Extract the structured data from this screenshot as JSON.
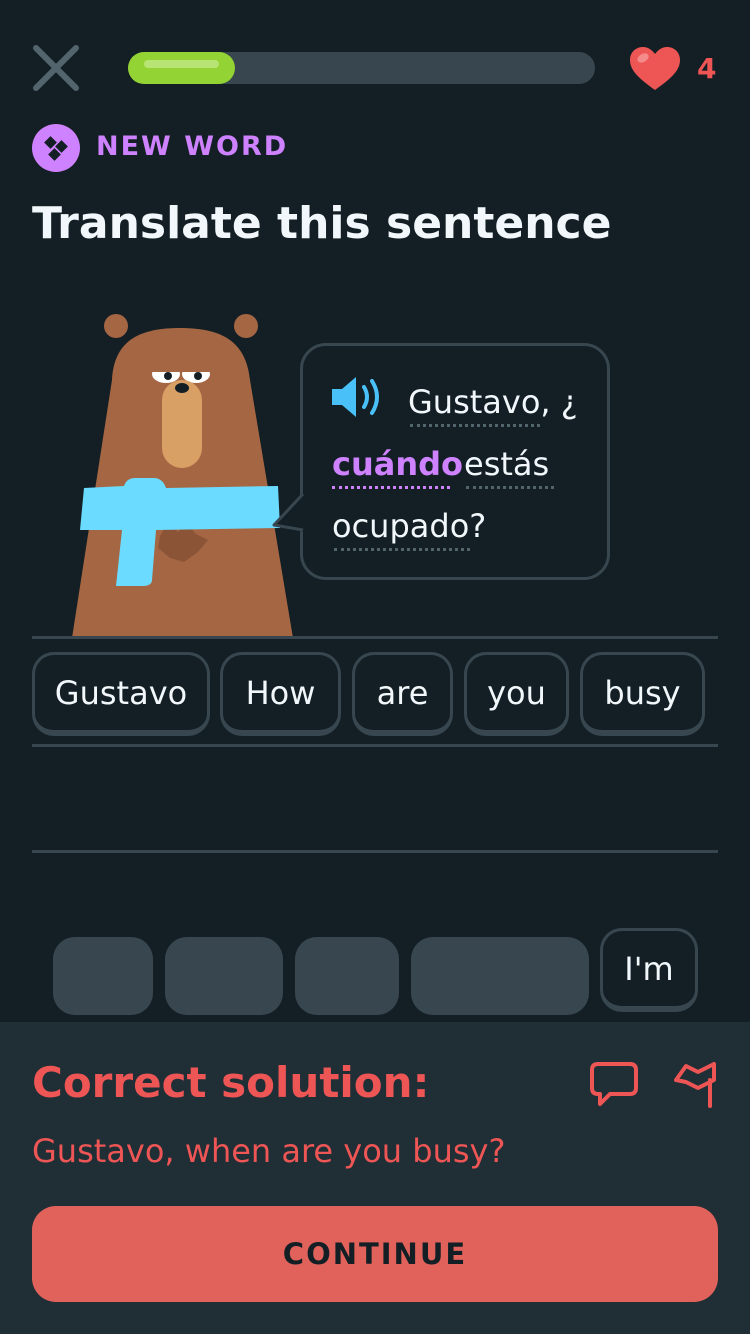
{
  "header": {
    "progress_fraction": 0.23,
    "hearts": "4"
  },
  "lesson": {
    "badge_label": "NEW WORD",
    "title": "Translate this sentence"
  },
  "bubble": {
    "words": [
      "Gustavo, ¿",
      "cuándo",
      "estás",
      "ocupado?"
    ],
    "highlighted_word": "cuándo"
  },
  "answer_tiles": [
    "Gustavo",
    "How",
    "are",
    "you",
    "busy"
  ],
  "word_bank": {
    "remaining_tile": "I'm",
    "used_slot_count": 4
  },
  "feedback": {
    "title": "Correct solution:",
    "solution": "Gustavo, when are you busy?",
    "continue_label": "CONTINUE"
  },
  "colors": {
    "background": "#131F24",
    "border": "#37464F",
    "progress": "#93D333",
    "accent_purple": "#CE82FF",
    "error_red": "#EE5555",
    "button_red": "#E0625B",
    "panel": "#202F36"
  }
}
